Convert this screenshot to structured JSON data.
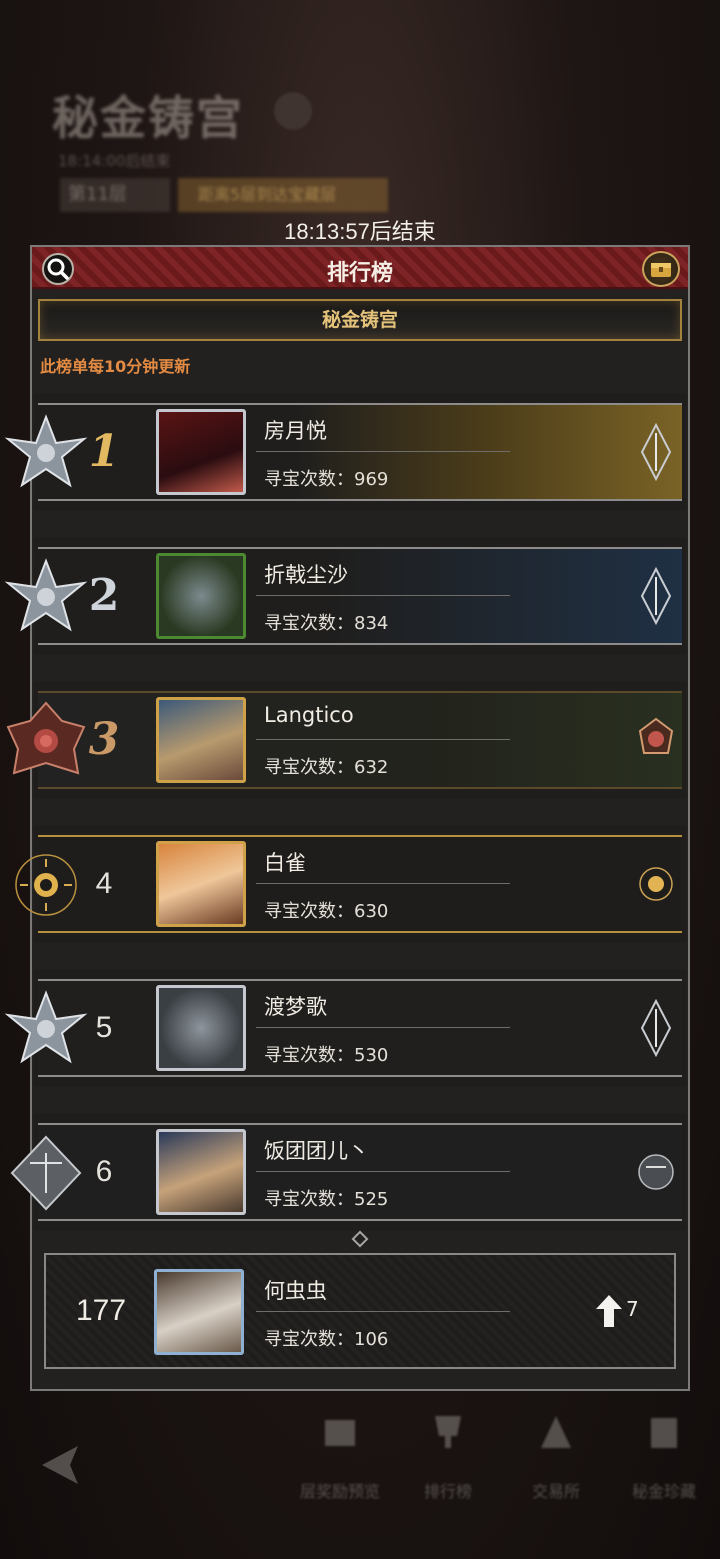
{
  "background": {
    "title": "秘金铸宫",
    "subtitle": "18:14:00后结束",
    "floor": "第11层",
    "goal": "距离5层到达宝藏层"
  },
  "timer_text": "18:13:57后结束",
  "header": {
    "title": "排行榜",
    "search_icon": "search-icon",
    "chest_icon": "treasure-chest-icon"
  },
  "subtitle_bar": "秘金铸宫",
  "notice": "此榜单每10分钟更新",
  "score_prefix": "寻宝次数：",
  "rows": [
    {
      "rank": "1",
      "name": "房月悦",
      "score": "969",
      "frame": "silver",
      "bg": "gold"
    },
    {
      "rank": "2",
      "name": "折戟尘沙",
      "score": "834",
      "frame": "green",
      "bg": "blue"
    },
    {
      "rank": "3",
      "name": "Langtico",
      "score": "632",
      "frame": "gold",
      "bg": "rose"
    },
    {
      "rank": "4",
      "name": "白雀",
      "score": "630",
      "frame": "gold",
      "bg": "sun"
    },
    {
      "rank": "5",
      "name": "渡梦歌",
      "score": "530",
      "frame": "silver",
      "bg": "plain"
    },
    {
      "rank": "6",
      "name": "饭团团儿丶",
      "score": "525",
      "frame": "silver",
      "bg": "libra"
    }
  ],
  "my_row": {
    "rank": "177",
    "name": "何虫虫",
    "score": "106",
    "change": "7",
    "change_icon": "arrow-up-icon"
  },
  "bottom_nav": [
    {
      "label": "层奖励预览",
      "icon": "reward-preview-icon"
    },
    {
      "label": "排行榜",
      "icon": "trophy-icon"
    },
    {
      "label": "交易所",
      "icon": "exchange-icon"
    },
    {
      "label": "秘金珍藏",
      "icon": "treasure-collection-icon"
    }
  ],
  "colors": {
    "header_red": "#7e2326",
    "gold_text": "#e4c27a",
    "notice_orange": "#e38b43"
  }
}
